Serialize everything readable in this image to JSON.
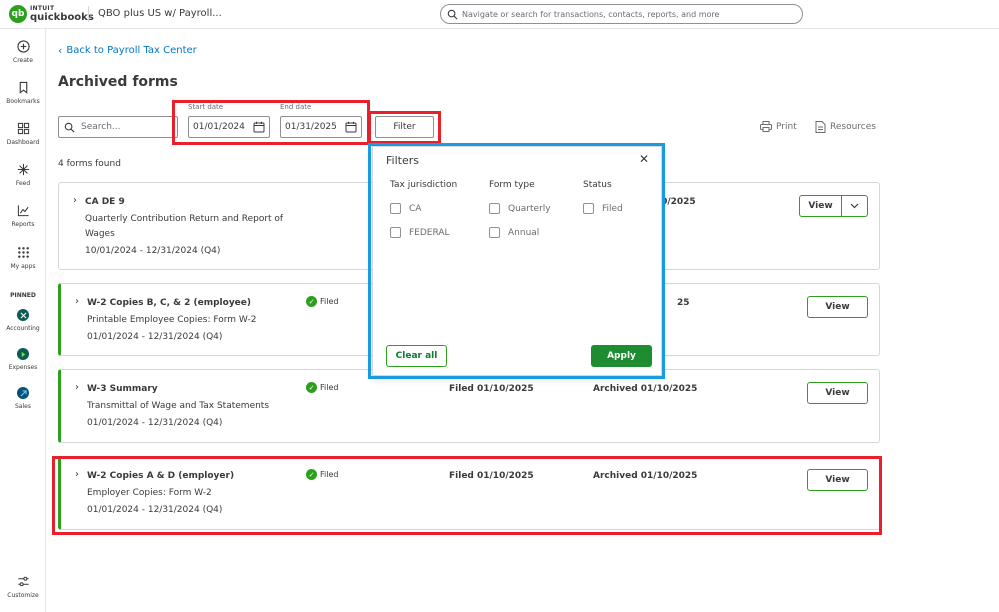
{
  "header": {
    "brand_line1": "INTUIT",
    "brand_line2": "quickbooks",
    "logo_glyph": "qb",
    "company": "QBO plus US w/ Payroll...",
    "search_placeholder": "Navigate or search for transactions, contacts, reports, and more"
  },
  "sidebar": {
    "items": [
      {
        "label": "Create",
        "icon": "plus-circle-icon"
      },
      {
        "label": "Bookmarks",
        "icon": "bookmark-icon"
      },
      {
        "label": "Dashboard",
        "icon": "dashboard-icon"
      },
      {
        "label": "Feed",
        "icon": "sparkle-icon"
      },
      {
        "label": "Reports",
        "icon": "chart-icon"
      },
      {
        "label": "My apps",
        "icon": "grid-icon"
      }
    ],
    "pinned_label": "PINNED",
    "pinned": [
      {
        "label": "Accounting",
        "icon": "accounting-icon"
      },
      {
        "label": "Expenses",
        "icon": "expenses-icon"
      },
      {
        "label": "Sales",
        "icon": "sales-icon"
      }
    ],
    "customize_label": "Customize"
  },
  "page": {
    "back_link": "Back to Payroll Tax Center",
    "title": "Archived forms",
    "search_placeholder": "Search...",
    "start_date_label": "Start date",
    "start_date": "01/01/2024",
    "end_date_label": "End date",
    "end_date": "01/31/2025",
    "filter_button": "Filter",
    "print_label": "Print",
    "resources_label": "Resources",
    "count_text": "4 forms found",
    "view_label": "View"
  },
  "forms": [
    {
      "title": "CA DE 9",
      "desc": "Quarterly Contribution Return and Report of Wages",
      "period": "10/01/2024 - 12/31/2024 (Q4)",
      "status": "",
      "filed": "",
      "archived": "01/10/2025"
    },
    {
      "title": "W-2 Copies B, C, & 2 (employee)",
      "desc": "Printable Employee Copies: Form W-2",
      "period": "01/01/2024 - 12/31/2024 (Q4)",
      "status": "Filed",
      "filed": "",
      "archived": "25"
    },
    {
      "title": "W-3 Summary",
      "desc": "Transmittal of Wage and Tax Statements",
      "period": "01/01/2024 - 12/31/2024 (Q4)",
      "status": "Filed",
      "filed": "Filed 01/10/2025",
      "archived": "Archived 01/10/2025"
    },
    {
      "title": "W-2 Copies A & D (employer)",
      "desc": "Employer Copies: Form W-2",
      "period": "01/01/2024 - 12/31/2024 (Q4)",
      "status": "Filed",
      "filed": "Filed 01/10/2025",
      "archived": "Archived 01/10/2025"
    }
  ],
  "filters": {
    "title": "Filters",
    "columns": [
      {
        "heading": "Tax jurisdiction",
        "options": [
          "CA",
          "FEDERAL"
        ]
      },
      {
        "heading": "Form type",
        "options": [
          "Quarterly",
          "Annual"
        ]
      },
      {
        "heading": "Status",
        "options": [
          "Filed"
        ]
      }
    ],
    "clear_label": "Clear all",
    "apply_label": "Apply"
  },
  "colors": {
    "accent_green": "#2ca01c",
    "link_blue": "#0077c5",
    "highlight_red": "#e8202a",
    "highlight_blue": "#1a9be0"
  }
}
